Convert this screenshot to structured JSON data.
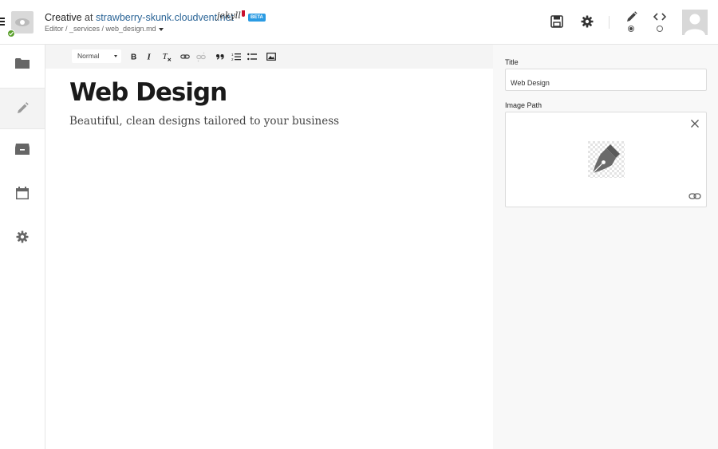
{
  "header": {
    "site_name": "Creative",
    "at_text": "at",
    "domain": "strawberry-skunk.cloudvent.net",
    "generator_logo": "jekyll",
    "beta_badge": "BETA",
    "breadcrumb": "Editor / _services / web_design.md",
    "save_icon": "save-icon",
    "settings_icon": "gear-icon",
    "mode_visual_icon": "pencil-icon",
    "mode_source_icon": "code-icon",
    "active_mode": "visual"
  },
  "sidebar": {
    "items": [
      {
        "name": "files",
        "icon": "folder-icon"
      },
      {
        "name": "editor",
        "icon": "pencil-icon",
        "active": true
      },
      {
        "name": "collections",
        "icon": "archive-icon"
      },
      {
        "name": "schedule",
        "icon": "calendar-icon"
      },
      {
        "name": "settings",
        "icon": "gear-icon"
      }
    ]
  },
  "toolbar": {
    "format_value": "Normal",
    "tools": [
      "bold",
      "italic",
      "clear-format",
      "link",
      "unlink",
      "blockquote",
      "ordered-list",
      "bullet-list",
      "image"
    ]
  },
  "document": {
    "title": "Web Design",
    "body": "Beautiful, clean designs tailored to your business"
  },
  "fields": {
    "title_label": "Title",
    "title_value": "Web Design",
    "image_label": "Image Path",
    "image_icon": "fountain-pen-icon"
  },
  "colors": {
    "link": "#2a6496",
    "beta": "#2b9be3",
    "status_ok": "#5aa02c"
  }
}
